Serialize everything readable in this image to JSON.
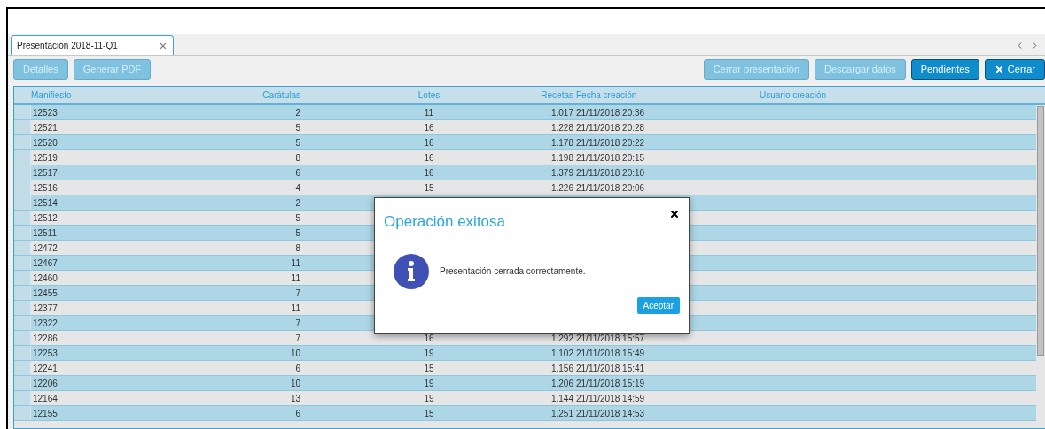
{
  "tabs": [
    {
      "label": "Presentación 2018-11-Q1",
      "selected": true
    }
  ],
  "toolbar_left": [
    {
      "label": "Detalles",
      "disabled": true
    },
    {
      "label": "Generar PDF",
      "disabled": true
    }
  ],
  "toolbar_right": [
    {
      "label": "Cerrar presentación",
      "disabled": true,
      "kind": "plain"
    },
    {
      "label": "Descargar datos",
      "disabled": true,
      "kind": "plain"
    },
    {
      "label": "Pendientes",
      "disabled": false,
      "kind": "plain"
    },
    {
      "label": "Cerrar",
      "disabled": false,
      "kind": "close"
    }
  ],
  "table": {
    "columns": [
      "Manifiesto",
      "Carátulas",
      "Lotes",
      "Recetas",
      "Fecha creación",
      "Usuario creación"
    ],
    "rows": [
      {
        "manifiesto": "12523",
        "caratulas": "2",
        "lotes": "11",
        "recetas": "1.017",
        "fecha": "21/11/2018 20:36"
      },
      {
        "manifiesto": "12521",
        "caratulas": "5",
        "lotes": "16",
        "recetas": "1.228",
        "fecha": "21/11/2018 20:28"
      },
      {
        "manifiesto": "12520",
        "caratulas": "5",
        "lotes": "16",
        "recetas": "1.178",
        "fecha": "21/11/2018 20:22"
      },
      {
        "manifiesto": "12519",
        "caratulas": "8",
        "lotes": "16",
        "recetas": "1.198",
        "fecha": "21/11/2018 20:15"
      },
      {
        "manifiesto": "12517",
        "caratulas": "6",
        "lotes": "16",
        "recetas": "1.379",
        "fecha": "21/11/2018 20:10"
      },
      {
        "manifiesto": "12516",
        "caratulas": "4",
        "lotes": "15",
        "recetas": "1.226",
        "fecha": "21/11/2018 20:06"
      },
      {
        "manifiesto": "12514",
        "caratulas": "2"
      },
      {
        "manifiesto": "12512",
        "caratulas": "5"
      },
      {
        "manifiesto": "12511",
        "caratulas": "5"
      },
      {
        "manifiesto": "12472",
        "caratulas": "8"
      },
      {
        "manifiesto": "12467",
        "caratulas": "11"
      },
      {
        "manifiesto": "12460",
        "caratulas": "11"
      },
      {
        "manifiesto": "12455",
        "caratulas": "7"
      },
      {
        "manifiesto": "12377",
        "caratulas": "11"
      },
      {
        "manifiesto": "12322",
        "caratulas": "7"
      },
      {
        "manifiesto": "12286",
        "caratulas": "7",
        "lotes": "16",
        "recetas": "1.292",
        "fecha": "21/11/2018 15:57"
      },
      {
        "manifiesto": "12253",
        "caratulas": "10",
        "lotes": "19",
        "recetas": "1.102",
        "fecha": "21/11/2018 15:49"
      },
      {
        "manifiesto": "12241",
        "caratulas": "6",
        "lotes": "15",
        "recetas": "1.156",
        "fecha": "21/11/2018 15:41"
      },
      {
        "manifiesto": "12206",
        "caratulas": "10",
        "lotes": "19",
        "recetas": "1.206",
        "fecha": "21/11/2018 15:19"
      },
      {
        "manifiesto": "12164",
        "caratulas": "13",
        "lotes": "19",
        "recetas": "1.144",
        "fecha": "21/11/2018 14:59"
      },
      {
        "manifiesto": "12155",
        "caratulas": "6",
        "lotes": "15",
        "recetas": "1.251",
        "fecha": "21/11/2018 14:53"
      }
    ]
  },
  "dialog": {
    "title": "Operación exitosa",
    "message": "Presentación cerrada correctamente.",
    "button": "Aceptar"
  }
}
